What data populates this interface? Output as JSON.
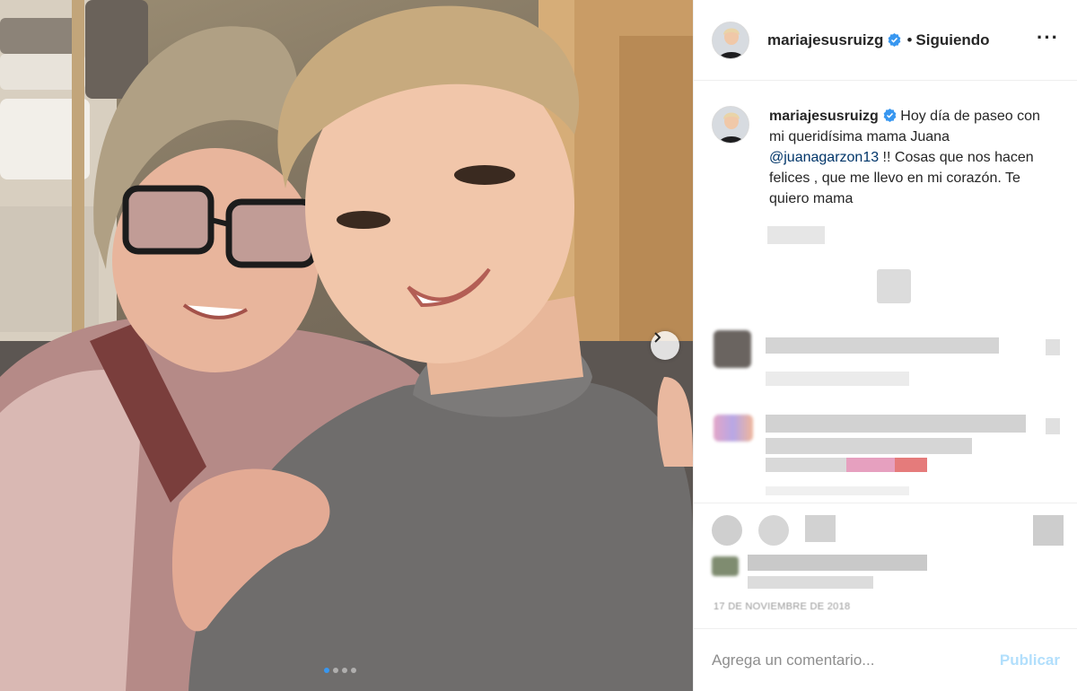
{
  "post": {
    "username": "mariajesusruizg",
    "follow_status": "Siguiendo",
    "more_icon": "more-dots-icon",
    "caption_text_1": "Hoy día de paseo con mi queridísima mama Juana ",
    "caption_mention": "@juanagarzon13",
    "caption_text_2": " !! Cosas que nos hacen felices , que me llevo en mi corazón. Te quiero mama",
    "date": "17 de noviembre de 2018"
  },
  "carousel": {
    "current": 1,
    "total": 4,
    "next_icon": "chevron-right-icon"
  },
  "comment": {
    "placeholder": "Agrega un comentario...",
    "publish_label": "Publicar"
  },
  "colors": {
    "accent": "#3897f0",
    "publish_disabled": "#b2dffc",
    "mention": "#003569"
  }
}
